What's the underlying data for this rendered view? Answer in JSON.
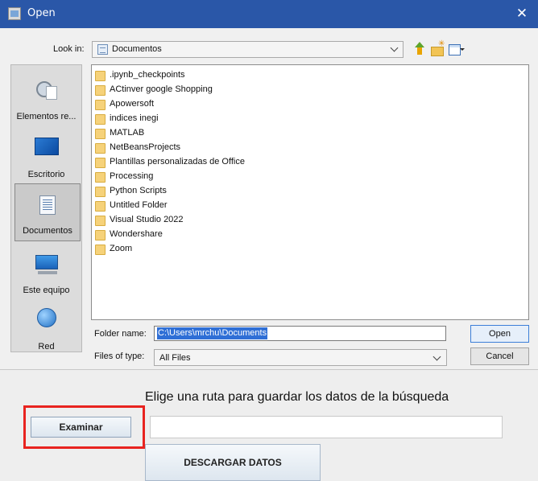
{
  "dialog": {
    "title": "Open",
    "close_glyph": "✕",
    "look_in_label": "Look in:",
    "look_in_value": "Documentos",
    "places": [
      {
        "label": "Elementos re...",
        "icon": "recent-items-icon"
      },
      {
        "label": "Escritorio",
        "icon": "desktop-icon"
      },
      {
        "label": "Documentos",
        "icon": "documents-icon",
        "selected": true
      },
      {
        "label": "Este equipo",
        "icon": "computer-icon"
      },
      {
        "label": "Red",
        "icon": "network-icon"
      }
    ],
    "files": [
      ".ipynb_checkpoints",
      "ACtinver google Shopping",
      "Apowersoft",
      "indices inegi",
      "MATLAB",
      "NetBeansProjects",
      "Plantillas personalizadas de Office",
      "Processing",
      "Python Scripts",
      "Untitled Folder",
      "Visual Studio 2022",
      "Wondershare",
      "Zoom"
    ],
    "folder_name_label": "Folder name:",
    "folder_name_value": "C:\\Users\\mrchu\\Documents",
    "files_of_type_label": "Files of type:",
    "files_of_type_value": "All Files",
    "open_label": "Open",
    "cancel_label": "Cancel"
  },
  "main": {
    "title": "Elige una ruta para guardar los datos de la búsqueda",
    "examinar_label": "Examinar",
    "path_value": "",
    "descargar_label": "DESCARGAR DATOS"
  },
  "colors": {
    "titlebar": "#2a57a8",
    "highlight": "#e8231f",
    "selection": "#2f6fd6"
  }
}
